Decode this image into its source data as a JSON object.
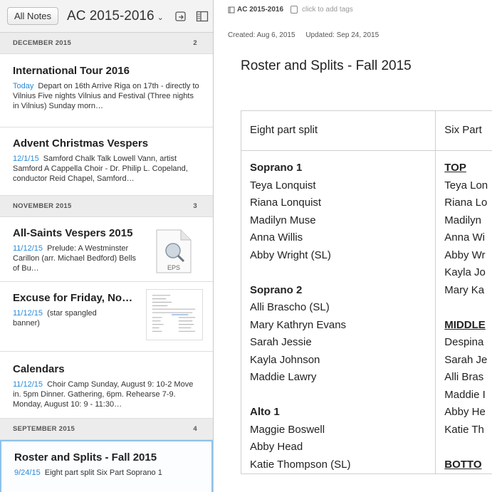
{
  "topbar": {
    "all_notes": "All Notes",
    "notebook": "AC 2015-2016",
    "caret": "⌄"
  },
  "list": {
    "sections": [
      {
        "label": "DECEMBER 2015",
        "count": "2"
      },
      {
        "label": "NOVEMBER 2015",
        "count": "3"
      },
      {
        "label": "SEPTEMBER 2015",
        "count": "4"
      }
    ],
    "notes": [
      {
        "title": "International Tour 2016",
        "date": "Today",
        "snippet": "Depart on 16th Arrive Riga on 17th - directly to Vilnius Five nights Vilnius and Festival (Three nights in Vilnius) Sunday morn…"
      },
      {
        "title": "Advent Christmas Vespers",
        "date": "12/1/15",
        "snippet": "Samford Chalk Talk Lowell Vann, artist Samford A Cappella Choir - Dr. Philip L. Copeland, conductor Reid Chapel, Samford…"
      },
      {
        "title": "All-Saints Vespers 2015",
        "date": "11/12/15",
        "snippet": "Prelude: A Westminster Carillon (arr. Michael Bedford) Bells of Bu…",
        "attachment_label": "EPS"
      },
      {
        "title": "Excuse for Friday, No…",
        "date": "11/12/15",
        "snippet": "(star spangled banner)"
      },
      {
        "title": "Calendars",
        "date": "11/12/15",
        "snippet": "Choir Camp Sunday, August 9: 10-2 Move in. 5pm Dinner. Gathering, 6pm. Rehearse 7-9. Monday, August 10: 9 - 11:30…"
      },
      {
        "title": "Roster and Splits - Fall 2015",
        "date": "9/24/15",
        "snippet": "Eight part split Six Part Soprano 1"
      }
    ]
  },
  "editor": {
    "notebook": "AC 2015-2016",
    "tag_hint": "click to add tags",
    "created": "Created: Aug 6, 2015",
    "updated": "Updated: Sep 24, 2015",
    "heading": "Roster and Splits - Fall 2015",
    "table": {
      "headers": [
        "Eight part split",
        "Six Part"
      ],
      "col1": [
        {
          "t": "Soprano 1",
          "k": "grp"
        },
        {
          "t": "Teya Lonquist"
        },
        {
          "t": "Riana Lonquist"
        },
        {
          "t": "Madilyn Muse"
        },
        {
          "t": "Anna Willis"
        },
        {
          "t": "Abby Wright (SL)"
        },
        {
          "t": "",
          "k": "gap"
        },
        {
          "t": "Soprano 2",
          "k": "grp"
        },
        {
          "t": "Alli Brascho (SL)"
        },
        {
          "t": "Mary Kathryn Evans"
        },
        {
          "t": "Sarah Jessie"
        },
        {
          "t": "Kayla Johnson"
        },
        {
          "t": "Maddie Lawry"
        },
        {
          "t": "",
          "k": "gap"
        },
        {
          "t": "Alto 1",
          "k": "grp"
        },
        {
          "t": "Maggie Boswell"
        },
        {
          "t": "Abby Head"
        },
        {
          "t": "Katie Thompson (SL)"
        }
      ],
      "col2": [
        {
          "t": "TOP",
          "k": "grp-u"
        },
        {
          "t": "Teya Lon"
        },
        {
          "t": "Riana Lo"
        },
        {
          "t": "Madilyn"
        },
        {
          "t": "Anna Wi"
        },
        {
          "t": "Abby Wr"
        },
        {
          "t": "Kayla Jo"
        },
        {
          "t": "Mary Ka"
        },
        {
          "t": "",
          "k": "gap"
        },
        {
          "t": "MIDDLE",
          "k": "grp-u"
        },
        {
          "t": "Despina"
        },
        {
          "t": "Sarah Je"
        },
        {
          "t": "Alli Bras"
        },
        {
          "t": "Maddie I"
        },
        {
          "t": "Abby He"
        },
        {
          "t": "Katie Th"
        },
        {
          "t": "",
          "k": "gap"
        },
        {
          "t": "BOTTO",
          "k": "grp-u"
        }
      ]
    }
  },
  "colors": {
    "accent": "#2a8ad8",
    "selected_border": "#8cc2ec"
  }
}
